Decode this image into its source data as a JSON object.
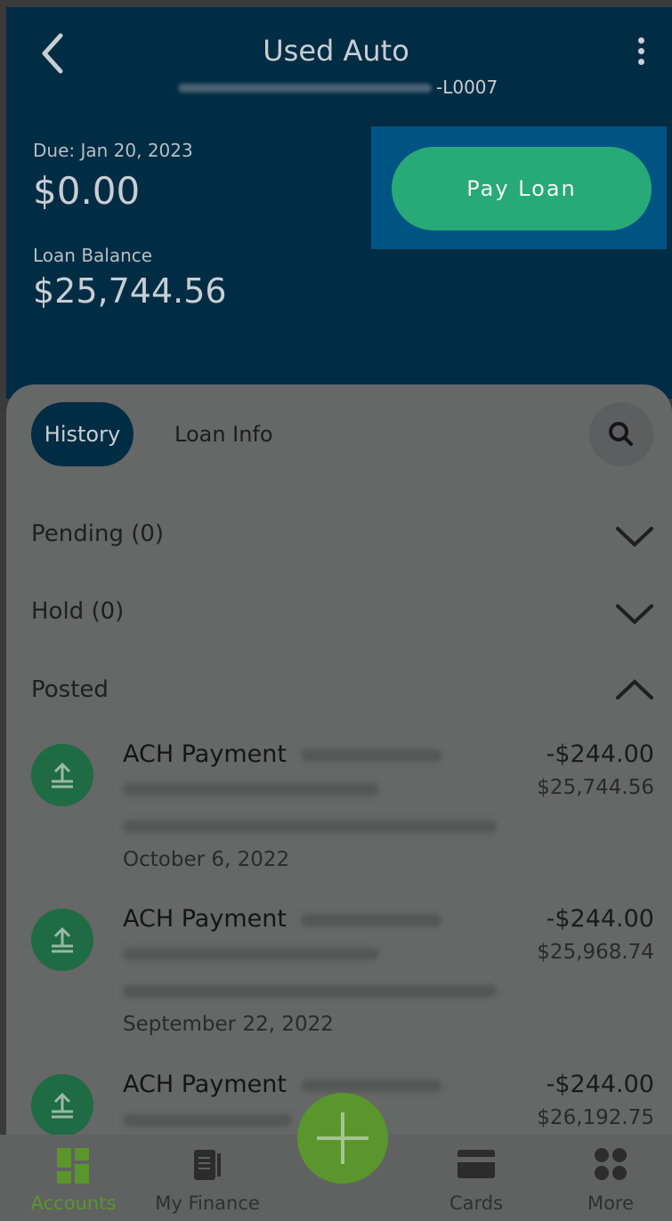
{
  "header": {
    "title": "Used Auto",
    "account_suffix": "-L0007",
    "due_label": "Due: Jan 20, 2023",
    "amount_due": "$0.00",
    "balance_label": "Loan Balance",
    "balance": "$25,744.56",
    "pay_button": "Pay Loan"
  },
  "tabs": {
    "history": "History",
    "loan_info": "Loan Info"
  },
  "sections": {
    "pending": "Pending (0)",
    "hold": "Hold (0)",
    "posted": "Posted"
  },
  "transactions": [
    {
      "title": "ACH Payment",
      "date": "October 6, 2022",
      "amount": "-$244.00",
      "balance": "$25,744.56"
    },
    {
      "title": "ACH Payment",
      "date": "September 22, 2022",
      "amount": "-$244.00",
      "balance": "$25,968.74"
    },
    {
      "title": "ACH Payment",
      "date": "",
      "amount": "-$244.00",
      "balance": "$26,192.75"
    }
  ],
  "nav": {
    "accounts": "Accounts",
    "my_finance": "My Finance",
    "cards": "Cards",
    "more": "More"
  },
  "colors": {
    "header_bg": "#002c44",
    "pay_button": "#27a978",
    "accent_green": "#5a962c",
    "highlight": "#005483"
  }
}
